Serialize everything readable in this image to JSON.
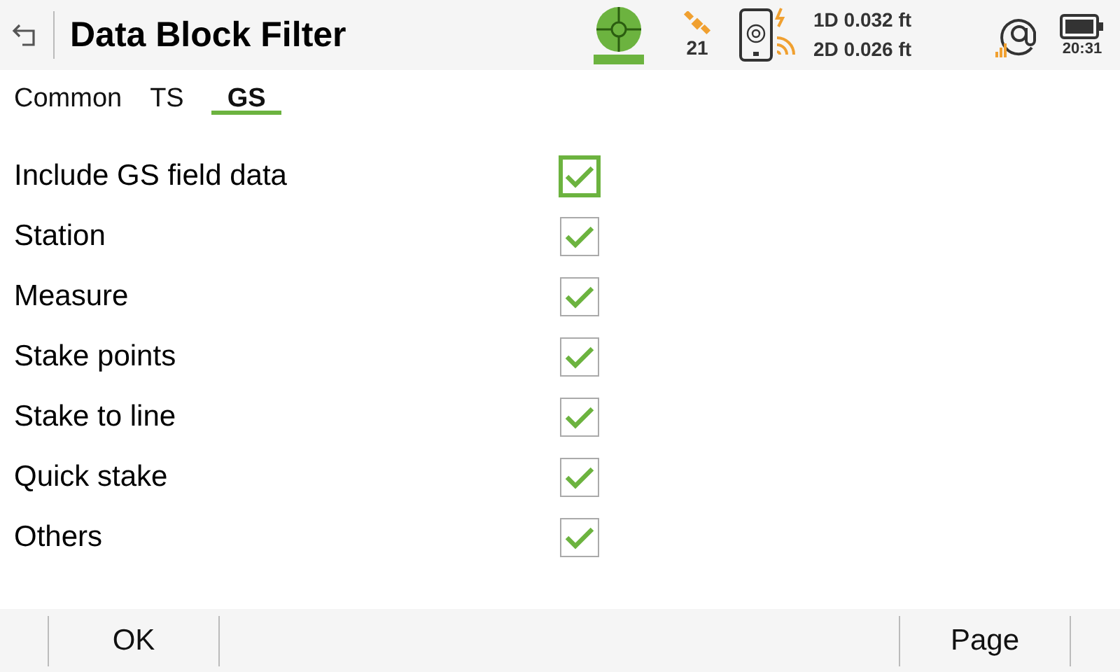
{
  "window": {
    "title": "Data Block Filter"
  },
  "status": {
    "satellites": "21",
    "precision_1d": "1D 0.032 ft",
    "precision_2d": "2D 0.026 ft",
    "time": "20:31"
  },
  "tabs": [
    {
      "label": "Common",
      "selected": false
    },
    {
      "label": "TS",
      "selected": false
    },
    {
      "label": "GS",
      "selected": true
    }
  ],
  "options": [
    {
      "label": "Include GS field data",
      "checked": true,
      "selected": true
    },
    {
      "label": "Station",
      "checked": true,
      "selected": false
    },
    {
      "label": "Measure",
      "checked": true,
      "selected": false
    },
    {
      "label": "Stake points",
      "checked": true,
      "selected": false
    },
    {
      "label": "Stake to line",
      "checked": true,
      "selected": false
    },
    {
      "label": "Quick stake",
      "checked": true,
      "selected": false
    },
    {
      "label": "Others",
      "checked": true,
      "selected": false
    }
  ],
  "soft_keys": [
    {
      "label": "OK"
    },
    {
      "label": "Page"
    }
  ]
}
